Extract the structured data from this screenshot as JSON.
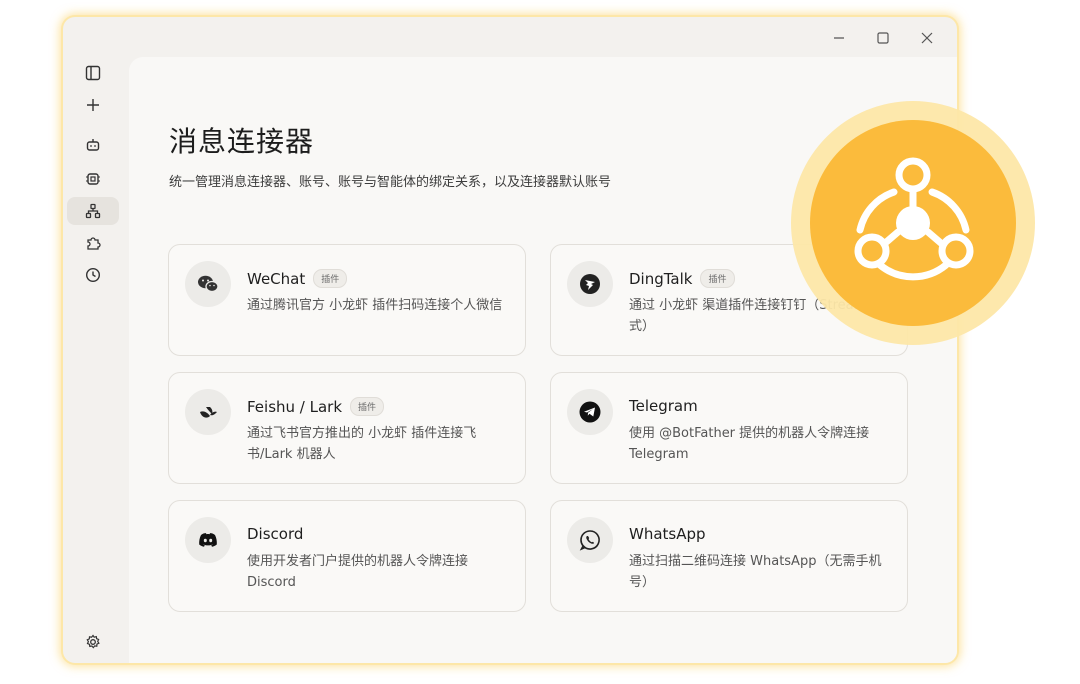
{
  "window": {
    "controls": [
      "minimize",
      "maximize",
      "close"
    ]
  },
  "sidebar": {
    "items": [
      {
        "icon": "sidebar-toggle-icon"
      },
      {
        "icon": "plus-icon"
      },
      {
        "icon": "robot-icon"
      },
      {
        "icon": "chip-icon"
      },
      {
        "icon": "network-icon",
        "active": true
      },
      {
        "icon": "puzzle-icon"
      },
      {
        "icon": "clock-icon"
      }
    ],
    "bottom": {
      "icon": "gear-icon"
    }
  },
  "page": {
    "title": "消息连接器",
    "subtitle": "统一管理消息连接器、账号、账号与智能体的绑定关系，以及连接器默认账号"
  },
  "connectors": [
    {
      "name": "WeChat",
      "badge": "插件",
      "desc": "通过腾讯官方 小龙虾 插件扫码连接个人微信",
      "icon": "wechat-icon"
    },
    {
      "name": "DingTalk",
      "badge": "插件",
      "desc": "通过 小龙虾 渠道插件连接钉钉（Stream 模式）",
      "icon": "dingtalk-icon"
    },
    {
      "name": "Feishu / Lark",
      "badge": "插件",
      "desc": "通过飞书官方推出的 小龙虾 插件连接飞书/Lark 机器人",
      "icon": "feishu-icon"
    },
    {
      "name": "Telegram",
      "badge": "",
      "desc": "使用 @BotFather 提供的机器人令牌连接 Telegram",
      "icon": "telegram-icon"
    },
    {
      "name": "Discord",
      "badge": "",
      "desc": "使用开发者门户提供的机器人令牌连接 Discord",
      "icon": "discord-icon"
    },
    {
      "name": "WhatsApp",
      "badge": "",
      "desc": "通过扫描二维码连接 WhatsApp（无需手机号）",
      "icon": "whatsapp-icon"
    }
  ],
  "colors": {
    "accent": "#fbbb3c",
    "accent_light": "#fde7a8",
    "window_bg": "#f3f1ee",
    "content_bg": "#f9f8f6"
  }
}
